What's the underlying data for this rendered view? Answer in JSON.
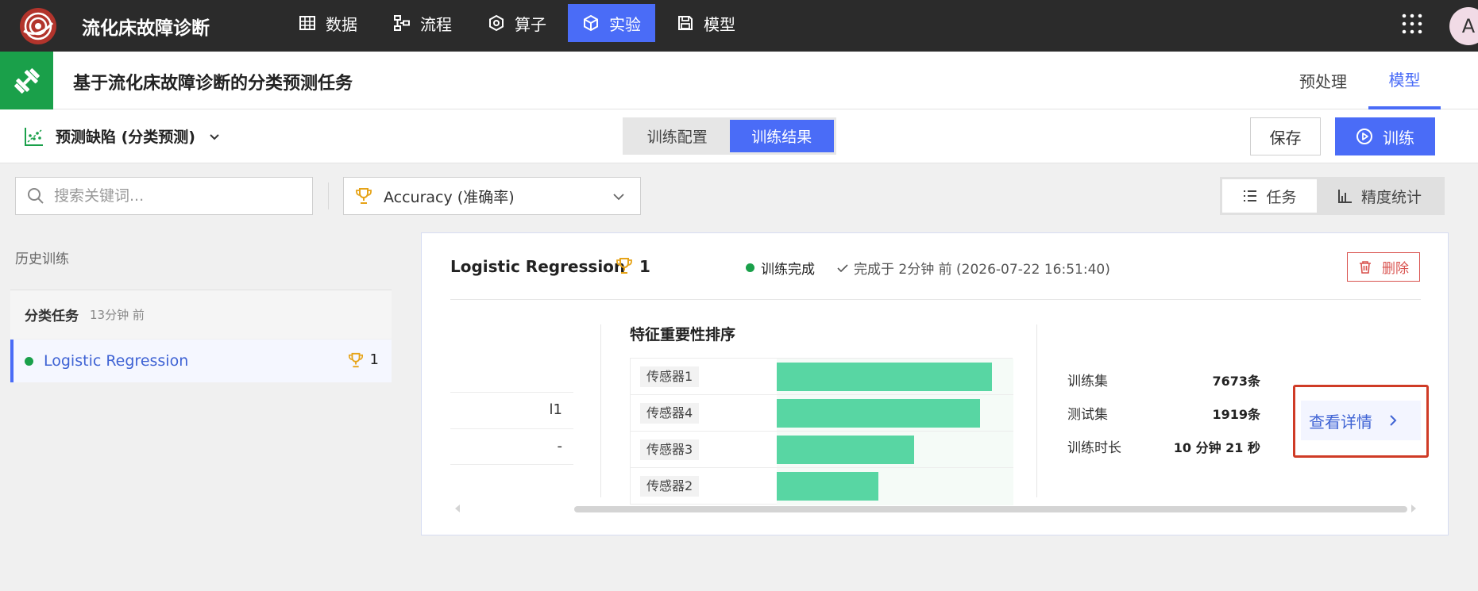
{
  "app": {
    "title": "流化床故障诊断"
  },
  "nav": [
    {
      "label": "数据",
      "icon": "table-icon"
    },
    {
      "label": "流程",
      "icon": "flow-icon"
    },
    {
      "label": "算子",
      "icon": "operator-icon"
    },
    {
      "label": "实验",
      "icon": "cube-icon",
      "active": true
    },
    {
      "label": "模型",
      "icon": "save-icon"
    }
  ],
  "user": {
    "avatar_letter": "A"
  },
  "task": {
    "title": "基于流化床故障诊断的分类预测任务",
    "tabs": [
      "预处理",
      "模型"
    ],
    "active_tab": "模型"
  },
  "toolbar": {
    "target": "预测缺陷 (分类预测)",
    "segments": [
      "训练配置",
      "训练结果"
    ],
    "active_segment": "训练结果",
    "save_label": "保存",
    "train_label": "训练"
  },
  "filters": {
    "search_placeholder": "搜索关键词...",
    "metric": "Accuracy (准确率)",
    "views": [
      "任务",
      "精度统计"
    ],
    "active_view": "任务"
  },
  "history": {
    "label": "历史训练",
    "groups": [
      {
        "name": "分类任务",
        "time": "13分钟 前",
        "runs": [
          {
            "name": "Logistic Regression",
            "rank": "1",
            "status_color": "#1aa04a"
          }
        ]
      }
    ]
  },
  "detail": {
    "model_name": "Logistic Regression",
    "rank": "1",
    "status": "训练完成",
    "completed": "完成于 2分钟 前 (2026-07-22 16:51:40)",
    "delete_label": "删除",
    "params": [
      "l1",
      "-"
    ],
    "feature_importance": {
      "title": "特征重要性排序",
      "items": [
        {
          "label": "传感器1",
          "value": 0.91
        },
        {
          "label": "传感器4",
          "value": 0.86
        },
        {
          "label": "传感器3",
          "value": 0.58
        },
        {
          "label": "传感器2",
          "value": 0.43
        }
      ]
    },
    "stats": [
      {
        "label": "训练集",
        "value": "7673条"
      },
      {
        "label": "测试集",
        "value": "1919条"
      },
      {
        "label": "训练时长",
        "value": "10 分钟 21 秒"
      }
    ],
    "view_detail_label": "查看详情"
  },
  "colors": {
    "topbar": "#2b2b2b",
    "accent": "#4a6cf7",
    "success": "#1aa04a",
    "bar": "#58d6a3",
    "danger": "#d9534f",
    "highlight": "#cf3b26"
  }
}
